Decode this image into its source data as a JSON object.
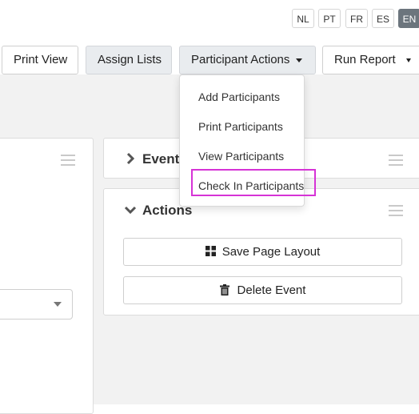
{
  "languages": [
    "NL",
    "PT",
    "FR",
    "ES",
    "EN"
  ],
  "active_language": "EN",
  "toolbar": {
    "print_view": "Print View",
    "assign_lists": "Assign Lists",
    "participant_actions": "Participant Actions",
    "run_report": "Run Report"
  },
  "participant_menu": {
    "items": [
      "Add Participants",
      "Print Participants",
      "View Participants",
      "Check In Participants"
    ],
    "highlighted_item": "Check In Participants"
  },
  "panels": {
    "event_title": "Event",
    "actions_title": "Actions",
    "save_layout": "Save Page Layout",
    "delete_event": "Delete Event"
  },
  "colors": {
    "highlight": "#d633d6",
    "active_lang_bg": "#6c757d"
  }
}
